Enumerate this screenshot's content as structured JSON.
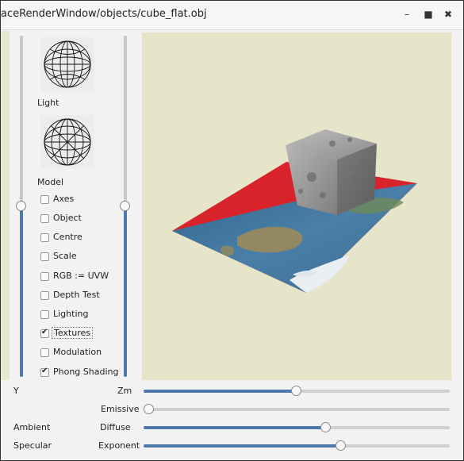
{
  "window": {
    "title": "aceRenderWindow/objects/cube_flat.obj",
    "controls": {
      "minimize": "–",
      "maximize": "■",
      "close": "✖"
    }
  },
  "left_panel": {
    "light_label": "Light",
    "model_label": "Model",
    "checkboxes": [
      {
        "label": "Axes",
        "checked": false
      },
      {
        "label": "Object",
        "checked": false
      },
      {
        "label": "Centre",
        "checked": false
      },
      {
        "label": "Scale",
        "checked": false
      },
      {
        "label": "RGB := UVW",
        "checked": false
      },
      {
        "label": "Depth Test",
        "checked": false
      },
      {
        "label": "Lighting",
        "checked": false
      },
      {
        "label": "Textures",
        "checked": true
      },
      {
        "label": "Modulation",
        "checked": false
      },
      {
        "label": "Phong Shading",
        "checked": true
      }
    ]
  },
  "sliders": {
    "left_vertical": {
      "level": 0.59
    },
    "right_vertical": {
      "level": 0.59
    },
    "zm": {
      "label": "Zm",
      "value": 0.5
    },
    "emissive": {
      "label": "Emissive",
      "value": 0.0
    },
    "diffuse": {
      "label": "Diffuse",
      "value": 0.6
    },
    "exponent": {
      "label": "Exponent",
      "value": 0.64
    }
  },
  "bottom_left_labels": {
    "y": "Y",
    "ambient": "Ambient",
    "specular": "Specular"
  },
  "colors": {
    "viewport_bg": "#e6e5c9",
    "slider_fill": "#4d78a8",
    "plane_red": "#d9232a",
    "ocean": "#3d6f99"
  },
  "icons": {
    "light_sphere": "wireframe-sphere-icon",
    "model_sphere": "wireframe-sphere-icon"
  }
}
